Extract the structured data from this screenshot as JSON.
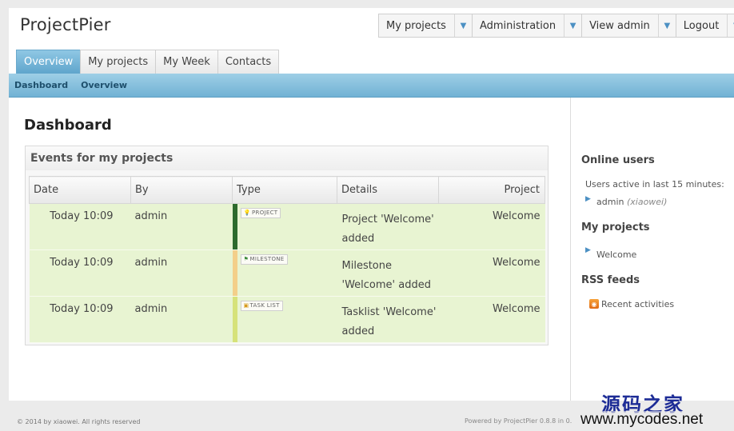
{
  "app": {
    "logo": "ProjectPier"
  },
  "account_menu": [
    {
      "label": "My projects",
      "arrow_icon": "chevron-down-icon"
    },
    {
      "label": "Administration",
      "arrow_icon": "chevron-down-icon"
    },
    {
      "label": "View admin",
      "arrow_icon": "chevron-down-icon"
    },
    {
      "label": "Logout",
      "arrow_icon": "chevron-down-icon"
    }
  ],
  "tabs": [
    {
      "label": "Overview",
      "active": true
    },
    {
      "label": "My projects"
    },
    {
      "label": "My Week"
    },
    {
      "label": "Contacts"
    }
  ],
  "subnav": {
    "items": [
      "Dashboard",
      "Overview"
    ]
  },
  "main": {
    "title": "Dashboard",
    "events": {
      "heading": "Events for my projects",
      "columns": [
        "Date",
        "By",
        "Type",
        "Details",
        "Project"
      ],
      "rows": [
        {
          "date": "Today 10:09",
          "by": "admin",
          "type_badge": "PROJECT",
          "type_icon": "lightbulb-icon",
          "type_color": "#2d6a2d",
          "details": "Project 'Welcome' added",
          "project": "Welcome"
        },
        {
          "date": "Today 10:09",
          "by": "admin",
          "type_badge": "MILESTONE",
          "type_icon": "flag-icon",
          "type_color": "#f3cf8a",
          "details": "Milestone 'Welcome' added",
          "project": "Welcome"
        },
        {
          "date": "Today 10:09",
          "by": "admin",
          "type_badge": "TASK LIST",
          "type_icon": "tasklist-icon",
          "type_color": "#d6e27a",
          "details": "Tasklist 'Welcome' added",
          "project": "Welcome"
        }
      ]
    }
  },
  "sidebar": {
    "online_users": {
      "heading": "Online users",
      "note": "Users active in last 15 minutes:",
      "users": [
        {
          "name": "admin",
          "alias": "(xiaowei)"
        }
      ]
    },
    "my_projects": {
      "heading": "My projects",
      "items": [
        "Welcome"
      ]
    },
    "rss": {
      "heading": "RSS feeds",
      "link": "Recent activities"
    }
  },
  "footer": {
    "left": "© 2014 by xiaowei. All rights reserved",
    "right": "Powered by ProjectPier 0.8.8 in 0."
  },
  "watermark": {
    "cn": "源码之家",
    "en": "www.mycodes.net"
  },
  "colors": {
    "accent": "#5fa5cc",
    "row_bg": "#e8f4d2",
    "arrow": "#4c90c3"
  }
}
